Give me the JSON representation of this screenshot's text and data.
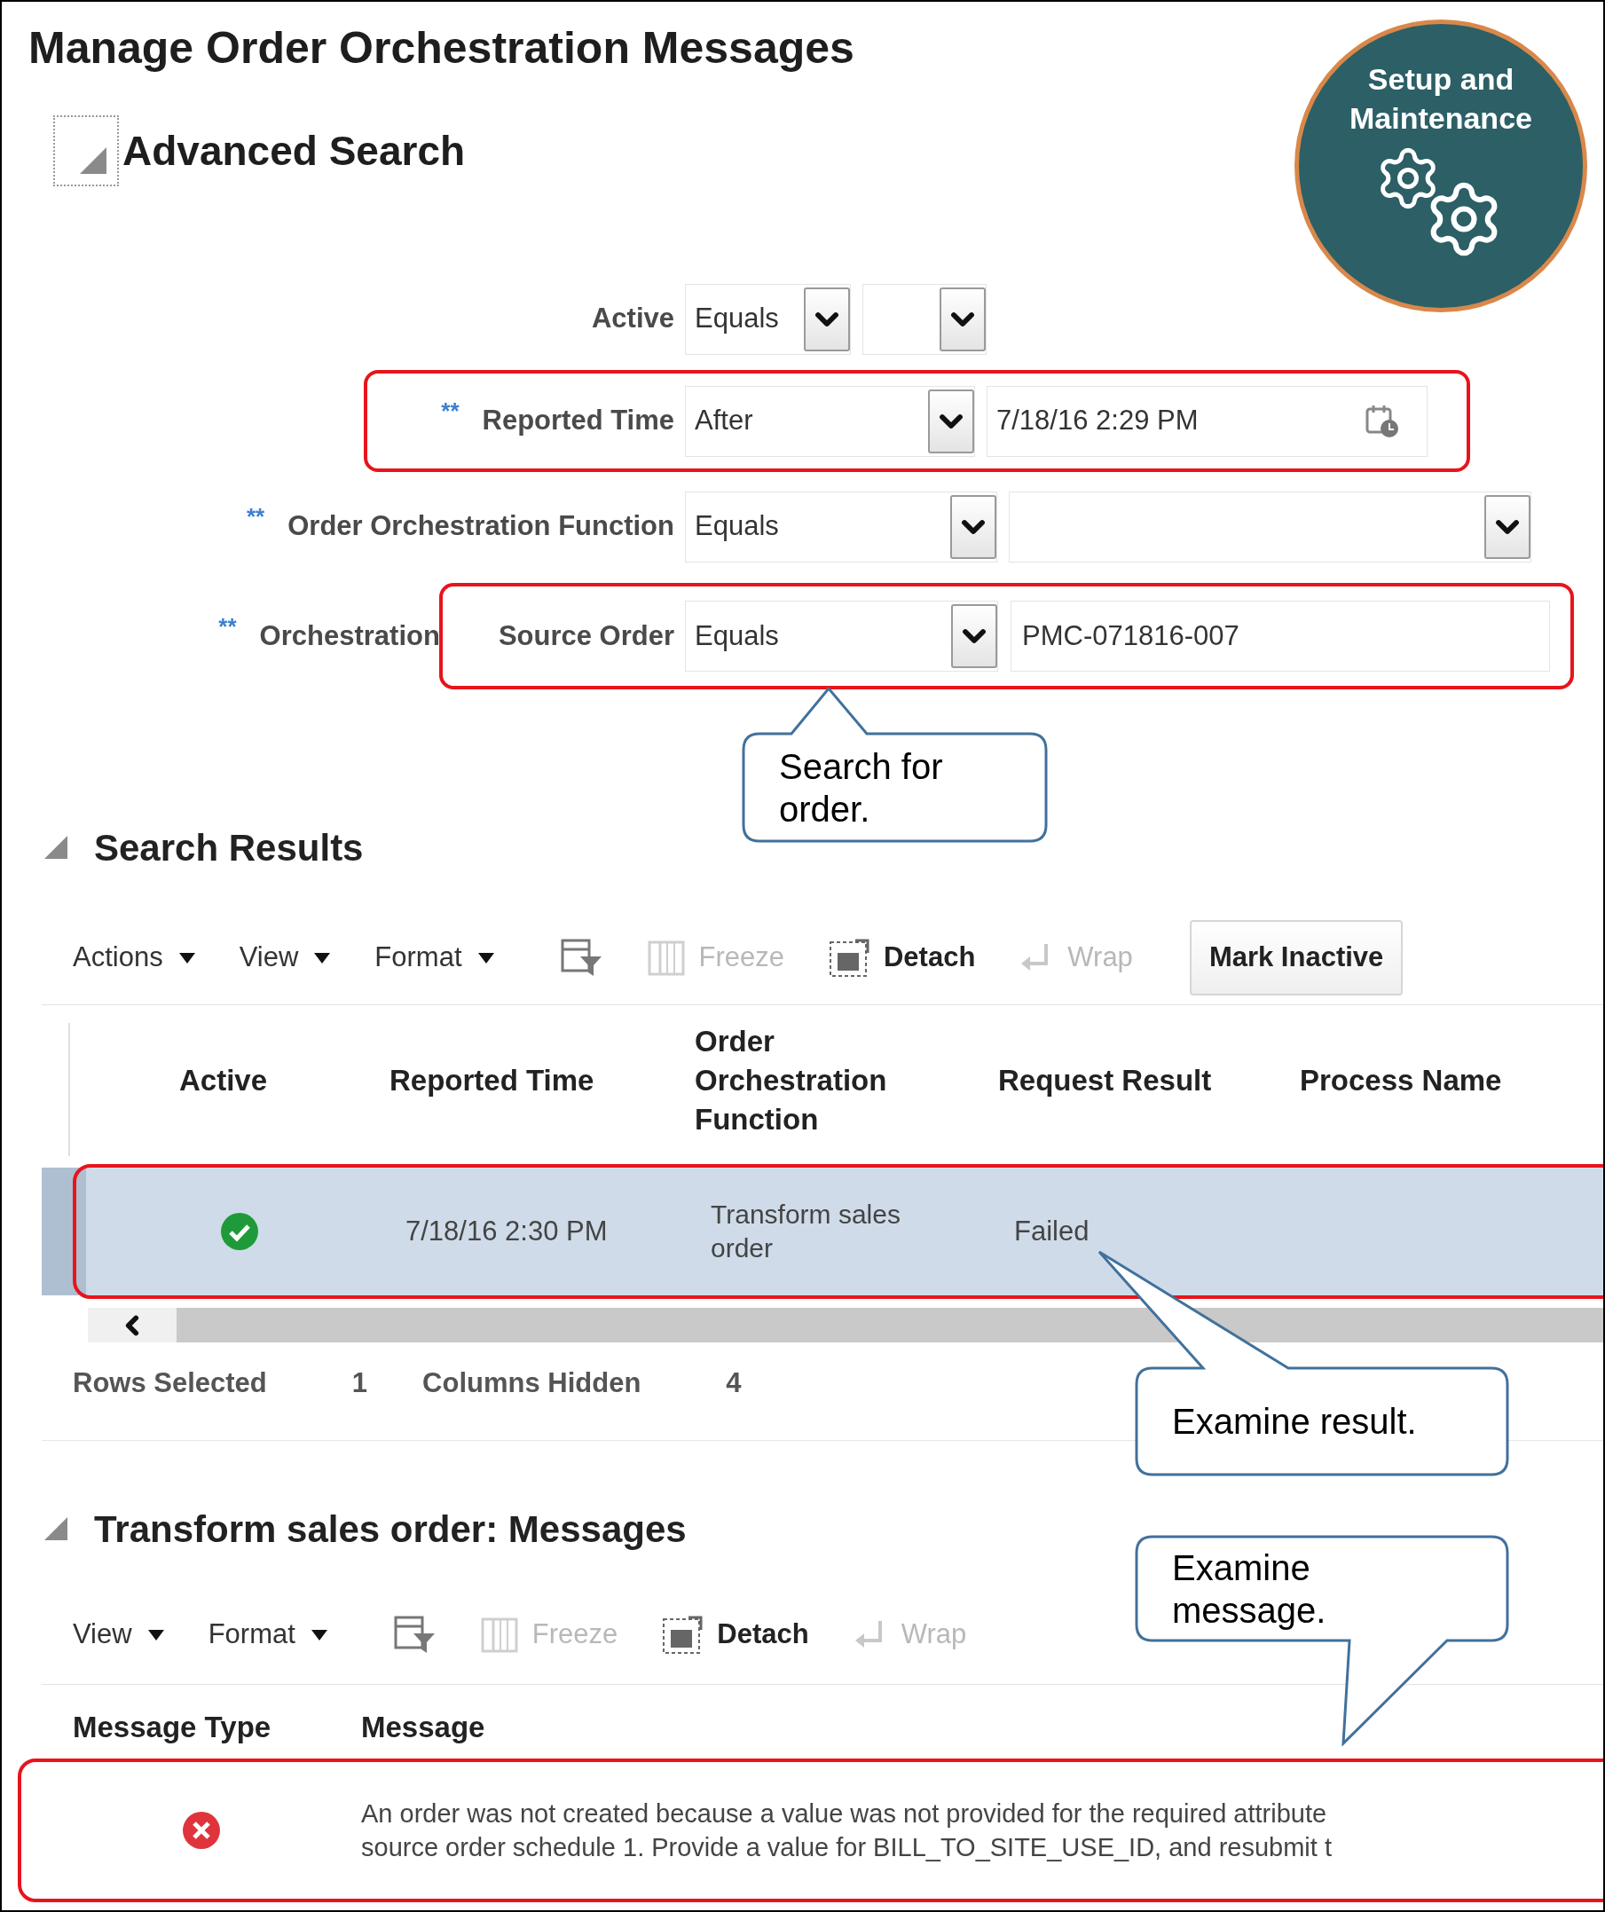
{
  "page_title": "Manage Order Orchestration Messages",
  "badge": {
    "text": "Setup and Maintenance"
  },
  "advanced_search": {
    "title": "Advanced Search",
    "expanded": true,
    "fields": [
      {
        "kind": "select",
        "label": "Active",
        "operator": "Equals",
        "highlighted": false
      },
      {
        "kind": "date",
        "marker": "**",
        "label": "Reported Time",
        "operator": "After",
        "value": "7/18/16 2:29 PM",
        "highlighted": true
      },
      {
        "kind": "select",
        "marker": "**",
        "label": "Order Orchestration Function",
        "operator": "Equals",
        "highlighted": false
      },
      {
        "kind": "text",
        "marker": "**",
        "label": "Orchestration",
        "sublabel": "Source Order",
        "operator": "Equals",
        "value": "PMC-071816-007",
        "highlighted": true
      }
    ]
  },
  "search_results": {
    "title": "Search Results",
    "expanded": true,
    "toolbar": [
      {
        "kind": "menu",
        "label": "Actions",
        "disabled": false
      },
      {
        "kind": "menu",
        "label": "View",
        "disabled": false
      },
      {
        "kind": "menu",
        "label": "Format",
        "disabled": false
      },
      {
        "kind": "filter",
        "disabled": false
      },
      {
        "kind": "freeze",
        "label": "Freeze",
        "disabled": true
      },
      {
        "kind": "detach",
        "label": "Detach",
        "disabled": false
      },
      {
        "kind": "wrap",
        "label": "Wrap",
        "disabled": true
      },
      {
        "kind": "button",
        "label": "Mark Inactive",
        "disabled": false
      }
    ],
    "columns": [
      "Active",
      "Reported Time",
      "Order Orchestration Function",
      "Request Result",
      "Process Name"
    ],
    "rows": [
      {
        "selected": true,
        "highlighted": true,
        "active": true,
        "reported_time": "7/18/16 2:30 PM",
        "function": "Transform sales order",
        "request_result": "Failed"
      }
    ],
    "status": [
      {
        "label": "Rows Selected",
        "value": "1"
      },
      {
        "label": "Columns Hidden",
        "value": "4"
      }
    ]
  },
  "messages": {
    "title": "Transform sales order: Messages",
    "expanded": true,
    "toolbar": [
      {
        "kind": "menu",
        "label": "View",
        "disabled": false
      },
      {
        "kind": "menu",
        "label": "Format",
        "disabled": false
      },
      {
        "kind": "filter",
        "disabled": false
      },
      {
        "kind": "freeze",
        "label": "Freeze",
        "disabled": true
      },
      {
        "kind": "detach",
        "label": "Detach",
        "disabled": false
      },
      {
        "kind": "wrap",
        "label": "Wrap",
        "disabled": true
      }
    ],
    "columns": [
      "Message Type",
      "Message"
    ],
    "rows": [
      {
        "kind": "error",
        "highlighted": true,
        "lines": [
          "An order was not created because a value was not provided for the required attribute",
          "source order schedule 1. Provide a value for BILL_TO_SITE_USE_ID, and resubmit t"
        ]
      }
    ]
  },
  "callouts": [
    {
      "text": "Search for order."
    },
    {
      "text": "Examine result."
    },
    {
      "text": "Examine message."
    }
  ]
}
